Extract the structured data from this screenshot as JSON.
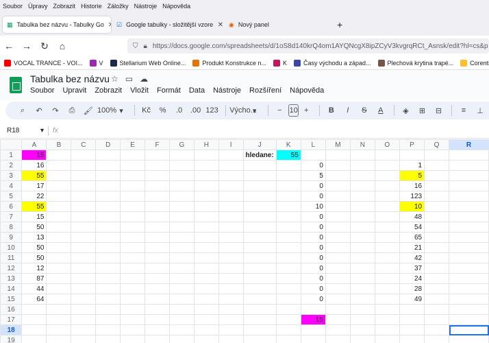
{
  "browser": {
    "menu": [
      "Soubor",
      "Úpravy",
      "Zobrazit",
      "Historie",
      "Záložky",
      "Nástroje",
      "Nápověda"
    ],
    "tabs": [
      {
        "label": "Tabulka bez názvu - Tabulky Go",
        "icon": "sheets-icon",
        "active": true
      },
      {
        "label": "Google tabulky - složitější vzore",
        "icon": "checkbox-icon",
        "active": false
      },
      {
        "label": "Nový panel",
        "icon": "firefox-icon",
        "active": false
      }
    ],
    "new_tab": "+",
    "url": "https://docs.google.com/spreadsheets/d/1oS8d140krQ4om1AYQNcgX8ipZCyV3kvgrqRCt_Asnsk/edit?hl=cs&p",
    "bookmarks": [
      {
        "label": "VOCAL TRANCE - VOI...",
        "color": "#ff0000"
      },
      {
        "label": "V",
        "color": "#9c27b0"
      },
      {
        "label": "Stellarium Web Online...",
        "color": "#1b2a49"
      },
      {
        "label": "Produkt Konstrukce n...",
        "color": "#e8710a"
      },
      {
        "label": "K",
        "color": "#c2185b"
      },
      {
        "label": "Časy východu a západ...",
        "color": "#3949ab"
      },
      {
        "label": "Plechová krytina trapé...",
        "color": "#795548"
      },
      {
        "label": "Corentium Home",
        "color": "#fbc02d"
      }
    ]
  },
  "sheets": {
    "title": "Tabulka bez názvu",
    "menu": [
      "Soubor",
      "Upravit",
      "Zobrazit",
      "Vložit",
      "Formát",
      "Data",
      "Nástroje",
      "Rozšíření",
      "Nápověda"
    ],
    "toolbar": {
      "zoom": "100%",
      "currency": "Kč",
      "percent": "%",
      "dec_minus": ".0",
      "dec_plus": ".00",
      "numfmt": "123",
      "font": "Výcho...",
      "font_size": "10"
    },
    "name_box": "R18",
    "fx": "fx"
  },
  "grid": {
    "columns": [
      "A",
      "B",
      "C",
      "D",
      "E",
      "F",
      "G",
      "H",
      "I",
      "J",
      "K",
      "L",
      "M",
      "N",
      "O",
      "P",
      "Q",
      "R"
    ],
    "rows": [
      {
        "n": "1",
        "A": "15",
        "J": "hledane:",
        "K": "55",
        "P": ""
      },
      {
        "n": "2",
        "A": "16",
        "L": "0",
        "P": "1"
      },
      {
        "n": "3",
        "A": "55",
        "L": "5",
        "P": "5"
      },
      {
        "n": "4",
        "A": "17",
        "L": "0",
        "P": "16"
      },
      {
        "n": "5",
        "A": "22",
        "L": "0",
        "P": "123"
      },
      {
        "n": "6",
        "A": "55",
        "L": "10",
        "P": "10"
      },
      {
        "n": "7",
        "A": "15",
        "L": "0",
        "P": "48"
      },
      {
        "n": "8",
        "A": "50",
        "L": "0",
        "P": "54"
      },
      {
        "n": "9",
        "A": "13",
        "L": "0",
        "P": "65"
      },
      {
        "n": "10",
        "A": "50",
        "L": "0",
        "P": "21"
      },
      {
        "n": "11",
        "A": "50",
        "L": "0",
        "P": "42"
      },
      {
        "n": "12",
        "A": "12",
        "L": "0",
        "P": "37"
      },
      {
        "n": "13",
        "A": "87",
        "L": "0",
        "P": "24"
      },
      {
        "n": "14",
        "A": "44",
        "L": "0",
        "P": "28"
      },
      {
        "n": "15",
        "A": "64",
        "L": "0",
        "P": "49"
      },
      {
        "n": "16"
      },
      {
        "n": "17",
        "L": "15"
      },
      {
        "n": "18"
      },
      {
        "n": "19"
      }
    ],
    "highlights": {
      "1:A": "#ff00ff",
      "3:A": "#ffff00",
      "6:A": "#ffff00",
      "1:K": "#00ffff",
      "3:P": "#ffff00",
      "6:P": "#ffff00",
      "17:L": "#ff00ff"
    },
    "selected_cell": "R18"
  }
}
